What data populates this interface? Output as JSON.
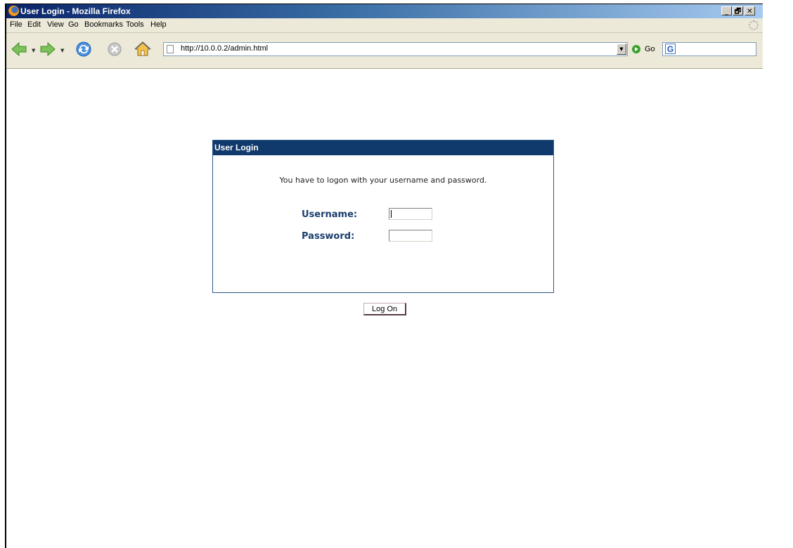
{
  "window": {
    "title": "User Login - Mozilla Firefox",
    "controls": [
      "_",
      "🗗",
      "✕"
    ]
  },
  "menu": {
    "items": [
      {
        "label": "File"
      },
      {
        "label": "Edit"
      },
      {
        "label": "View"
      },
      {
        "label": "Go"
      },
      {
        "label": "Bookmarks"
      },
      {
        "label": "Tools"
      },
      {
        "label": "Help"
      }
    ]
  },
  "toolbar": {
    "url": "http://10.0.0.2/admin.html",
    "go_label": "Go",
    "icons": [
      "back-icon",
      "forward-icon",
      "reload-icon",
      "stop-icon",
      "home-icon",
      "go-icon",
      "google-search-icon"
    ],
    "search_placeholder": ""
  },
  "login": {
    "header": "User Login",
    "message": "You have to logon with your username and password.",
    "username_label": "Username:",
    "password_label": "Password:",
    "username_value": "",
    "password_value": "",
    "submit_label": "Log On"
  },
  "colors": {
    "header_bg": "#0f3a6b",
    "label_color": "#1a3f6e",
    "chrome_bg": "#ece9d8"
  }
}
